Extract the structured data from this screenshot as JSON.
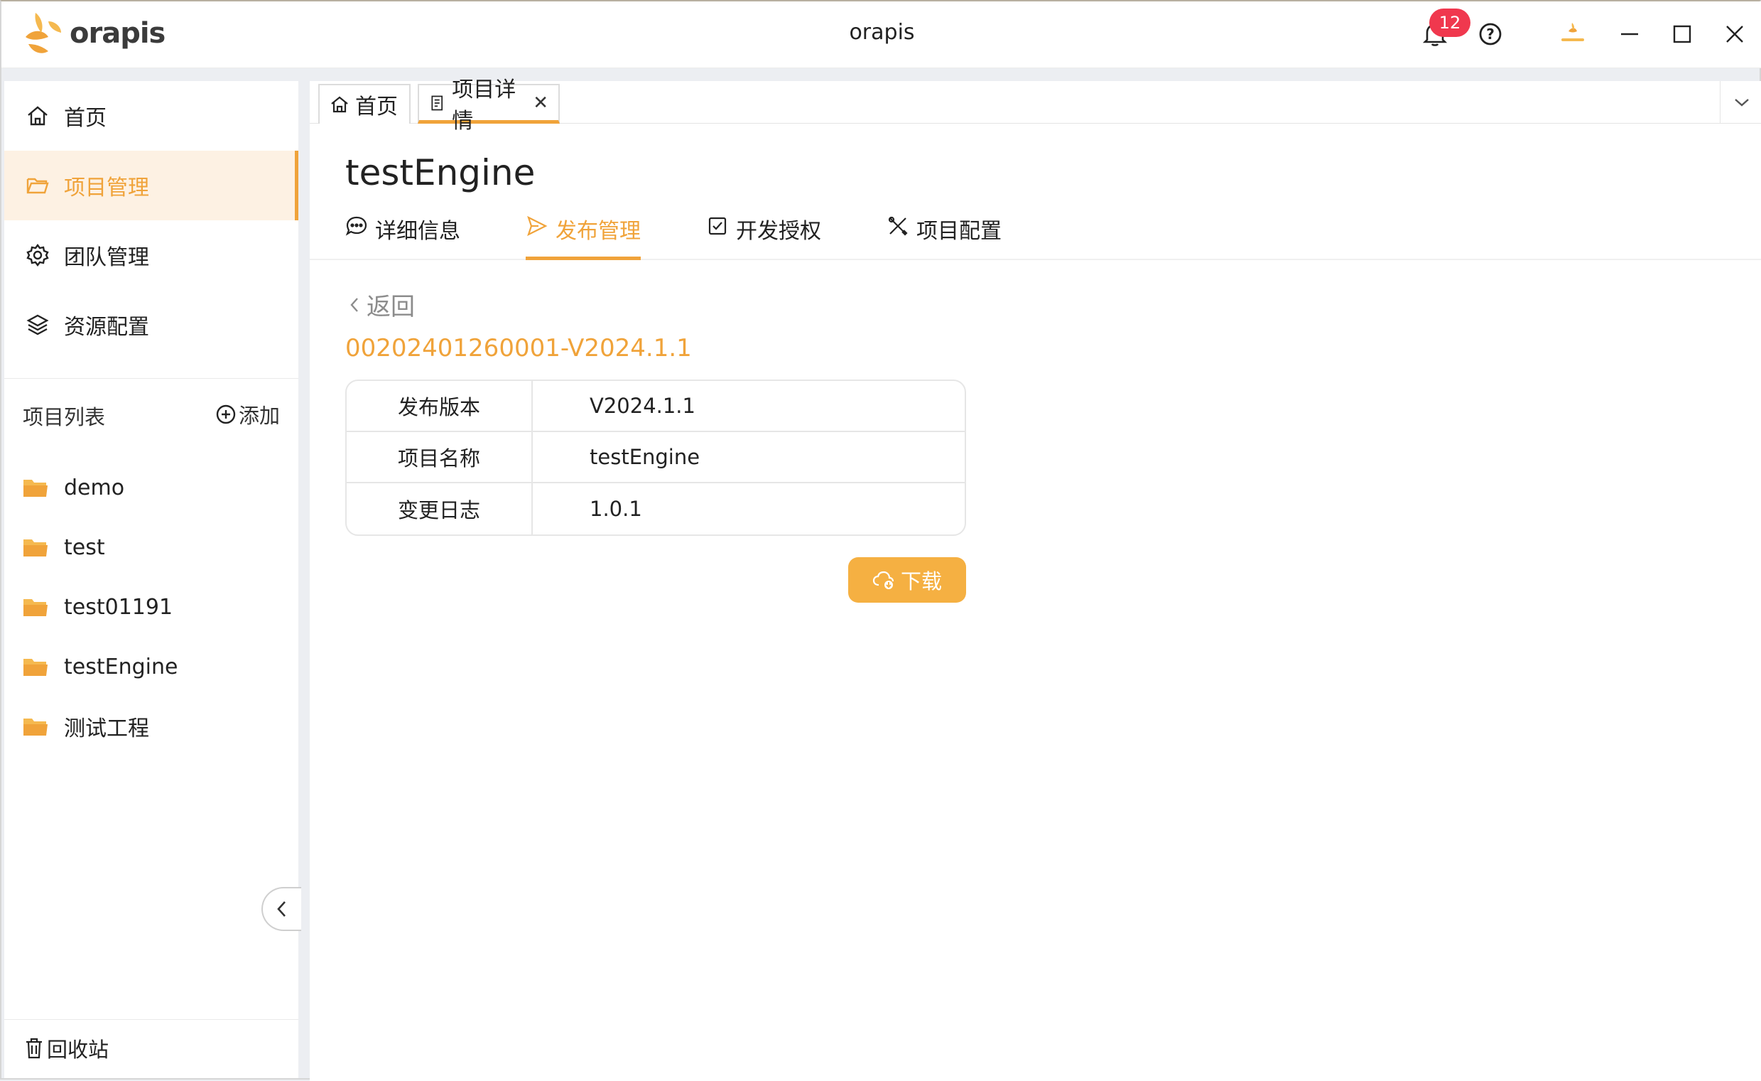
{
  "app": {
    "logo_text": "orapis",
    "title": "orapis",
    "notification_count": "12",
    "accent_color": "#f0a33a"
  },
  "sidebar": {
    "nav": [
      {
        "label": "首页",
        "icon": "home-icon"
      },
      {
        "label": "项目管理",
        "icon": "folder-open-icon",
        "active": true
      },
      {
        "label": "团队管理",
        "icon": "gear-icon"
      },
      {
        "label": "资源配置",
        "icon": "layers-icon"
      }
    ],
    "project_list_title": "项目列表",
    "add_label": "添加",
    "projects": [
      "demo",
      "test",
      "test01191",
      "testEngine",
      "测试工程"
    ],
    "recycle_label": "回收站"
  },
  "tabs": [
    {
      "label": "首页"
    },
    {
      "label": "项目详情",
      "active": true
    }
  ],
  "page": {
    "title": "testEngine",
    "subtabs": [
      {
        "label": "详细信息"
      },
      {
        "label": "发布管理",
        "active": true
      },
      {
        "label": "开发授权"
      },
      {
        "label": "项目配置"
      }
    ],
    "back_label": "返回",
    "release_id": "00202401260001-V2024.1.1",
    "info": [
      {
        "key": "发布版本",
        "value": "V2024.1.1"
      },
      {
        "key": "项目名称",
        "value": "testEngine"
      },
      {
        "key": "变更日志",
        "value": "1.0.1"
      }
    ],
    "download_label": "下载"
  }
}
